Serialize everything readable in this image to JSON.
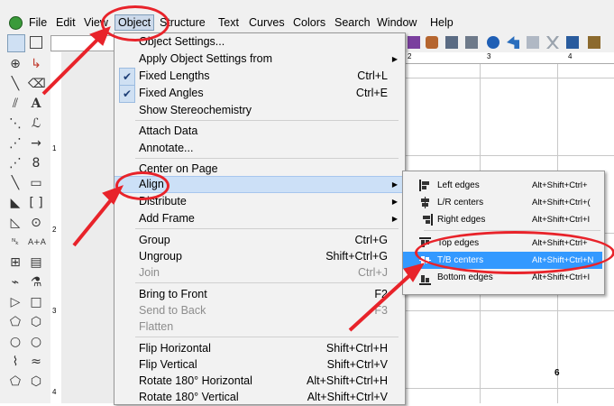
{
  "menubar": {
    "items": [
      "File",
      "Edit",
      "View",
      "Object",
      "Structure",
      "Text",
      "Curves",
      "Colors",
      "Search",
      "Window",
      "Help"
    ]
  },
  "ruler": {
    "vertical": [
      "1",
      "2",
      "3",
      "4"
    ],
    "horizontal": [
      "2",
      "3",
      "4"
    ]
  },
  "object_menu": {
    "items": [
      {
        "label": "Object Settings...",
        "shortcut": ""
      },
      {
        "label": "Apply Object Settings from",
        "shortcut": ""
      },
      {
        "label": "Fixed Lengths",
        "shortcut": "Ctrl+L"
      },
      {
        "label": "Fixed Angles",
        "shortcut": "Ctrl+E"
      },
      {
        "label": "Show Stereochemistry",
        "shortcut": ""
      },
      {
        "label": "Attach Data",
        "shortcut": ""
      },
      {
        "label": "Annotate...",
        "shortcut": ""
      },
      {
        "label": "Center on Page",
        "shortcut": ""
      },
      {
        "label": "Align",
        "shortcut": ""
      },
      {
        "label": "Distribute",
        "shortcut": ""
      },
      {
        "label": "Add Frame",
        "shortcut": ""
      },
      {
        "label": "Group",
        "shortcut": "Ctrl+G"
      },
      {
        "label": "Ungroup",
        "shortcut": "Shift+Ctrl+G"
      },
      {
        "label": "Join",
        "shortcut": "Ctrl+J"
      },
      {
        "label": "Bring to Front",
        "shortcut": "F2"
      },
      {
        "label": "Send to Back",
        "shortcut": "F3"
      },
      {
        "label": "Flatten",
        "shortcut": ""
      },
      {
        "label": "Flip Horizontal",
        "shortcut": "Shift+Ctrl+H"
      },
      {
        "label": "Flip Vertical",
        "shortcut": "Shift+Ctrl+V"
      },
      {
        "label": "Rotate 180° Horizontal",
        "shortcut": "Alt+Shift+Ctrl+H"
      },
      {
        "label": "Rotate 180° Vertical",
        "shortcut": "Alt+Shift+Ctrl+V"
      }
    ]
  },
  "align_submenu": {
    "items": [
      {
        "label": "Left edges",
        "shortcut": "Alt+Shift+Ctrl+"
      },
      {
        "label": "L/R centers",
        "shortcut": "Alt+Shift+Ctrl+("
      },
      {
        "label": "Right edges",
        "shortcut": "Alt+Shift+Ctrl+I"
      },
      {
        "label": "Top edges",
        "shortcut": "Alt+Shift+Ctrl+"
      },
      {
        "label": "T/B centers",
        "shortcut": "Alt+Shift+Ctrl+N"
      },
      {
        "label": "Bottom edges",
        "shortcut": "Alt+Shift+Ctrl+I"
      }
    ]
  },
  "canvas": {
    "label": "6"
  },
  "colors": {
    "accent_highlight": "#3399ff",
    "menu_highlight": "#cce0f7",
    "annotation_red": "#e8232a"
  }
}
